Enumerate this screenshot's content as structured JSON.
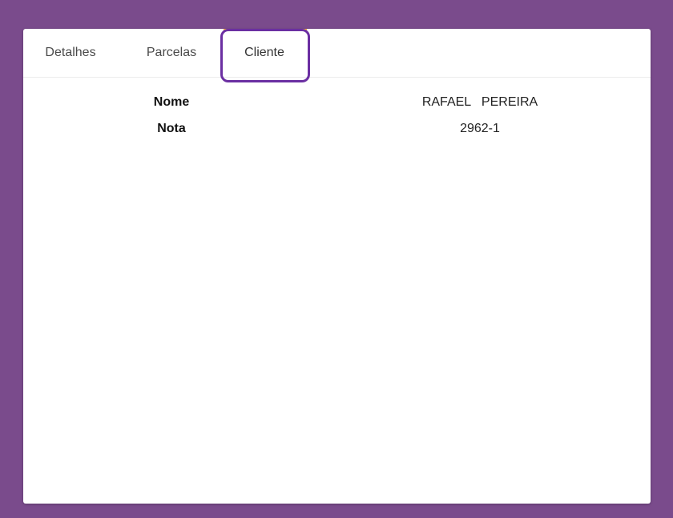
{
  "tabs": {
    "detalhes": "Detalhes",
    "parcelas": "Parcelas",
    "cliente": "Cliente",
    "active": "Cliente"
  },
  "cliente": {
    "nome_label": "Nome",
    "nome_value": "RAFAEL   PEREIRA",
    "nota_label": "Nota",
    "nota_value": "2962-1"
  },
  "colors": {
    "background": "#7a4b8c",
    "panel": "#ffffff",
    "tab_indicator": "#f6b73c",
    "highlight_border": "#6b2fa2"
  }
}
